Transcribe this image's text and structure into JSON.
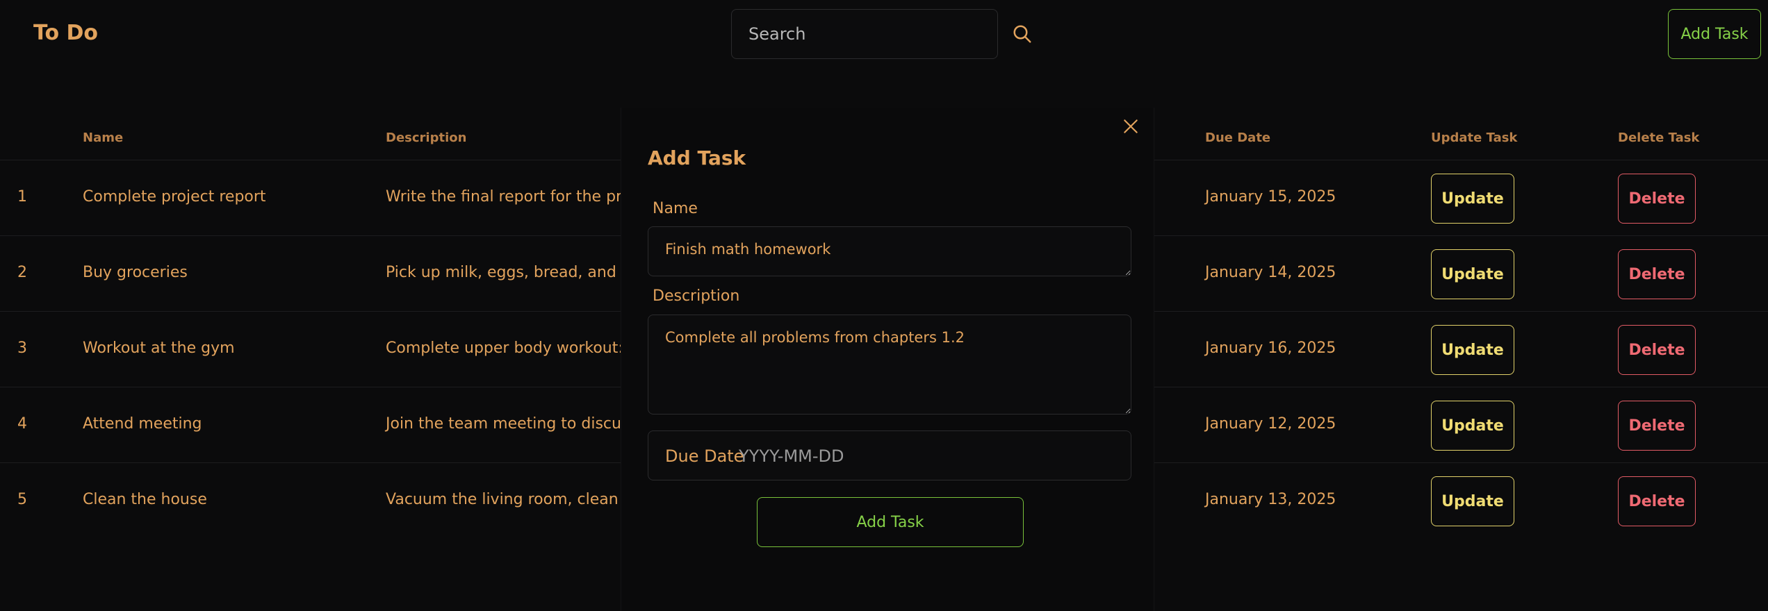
{
  "header": {
    "title": "To Do",
    "search_placeholder": "Search",
    "add_task_label": "Add Task"
  },
  "table": {
    "columns": {
      "name": "Name",
      "description": "Description",
      "due_date": "Due Date",
      "update": "Update Task",
      "delete": "Delete Task"
    },
    "rows": [
      {
        "num": "1",
        "name": "Complete project report",
        "description": "Write the final report for the project,",
        "due": "January 15, 2025",
        "update": "Update",
        "delete": "Delete"
      },
      {
        "num": "2",
        "name": "Buy groceries",
        "description": "Pick up milk, eggs, bread, and vegeta",
        "due": "January 14, 2025",
        "update": "Update",
        "delete": "Delete"
      },
      {
        "num": "3",
        "name": "Workout at the gym",
        "description": "Complete upper body workout: push",
        "due": "January 16, 2025",
        "update": "Update",
        "delete": "Delete"
      },
      {
        "num": "4",
        "name": "Attend meeting",
        "description": "Join the team meeting to discuss the",
        "due": "January 12, 2025",
        "update": "Update",
        "delete": "Delete"
      },
      {
        "num": "5",
        "name": "Clean the house",
        "description": "Vacuum the living room, clean the kit",
        "due": "January 13, 2025",
        "update": "Update",
        "delete": "Delete"
      }
    ]
  },
  "modal": {
    "title": "Add Task",
    "name_label": "Name",
    "name_value": "Finish math homework",
    "description_label": "Description",
    "description_value": "Complete all problems from chapters 1.2",
    "due_label": "Due Date",
    "due_placeholder": "YYYY-MM-DD",
    "submit_label": "Add Task"
  },
  "colors": {
    "accent": "#e2a35d",
    "add": "#79c23a",
    "update": "#e2d26a",
    "delete": "#e25b65",
    "background": "#0b0b0c"
  }
}
